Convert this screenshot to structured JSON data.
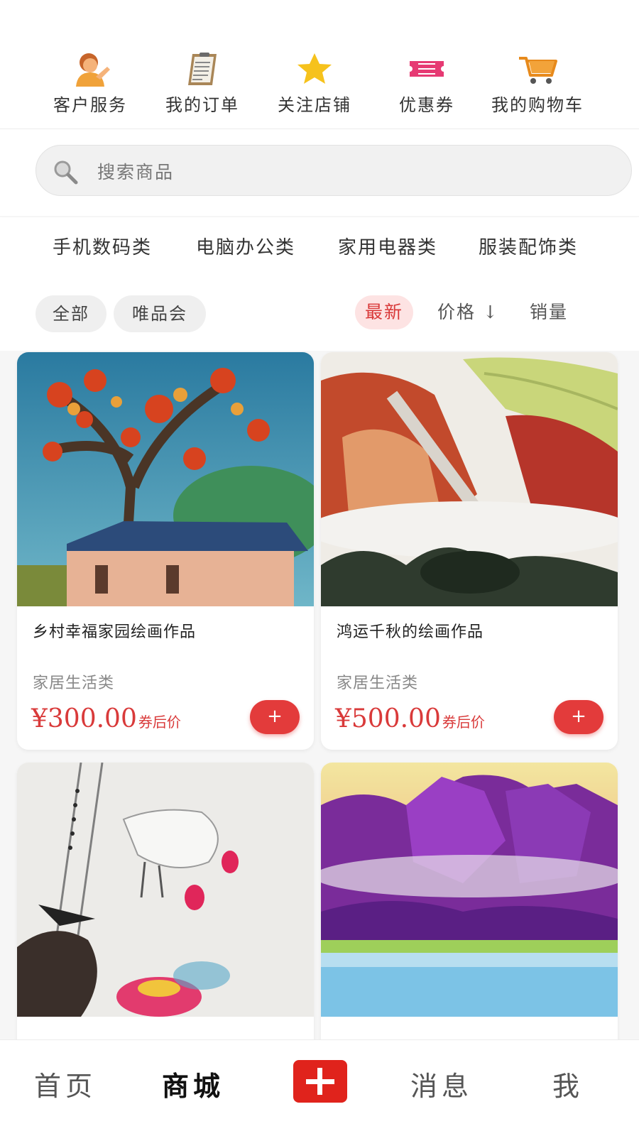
{
  "quick_menu": [
    {
      "label": "客户服务",
      "icon": "customer-service-icon"
    },
    {
      "label": "我的订单",
      "icon": "clipboard-icon"
    },
    {
      "label": "关注店铺",
      "icon": "star-icon"
    },
    {
      "label": "优惠券",
      "icon": "ticket-icon"
    },
    {
      "label": "我的购物车",
      "icon": "shopping-cart-icon"
    }
  ],
  "search": {
    "placeholder": "搜索商品",
    "icon": "search-icon"
  },
  "categories": [
    "手机数码类",
    "电脑办公类",
    "家用电器类",
    "服装配饰类"
  ],
  "filters": {
    "chips": [
      "全部",
      "唯品会"
    ],
    "sort": {
      "newest": "最新",
      "price": "价格 ↓",
      "sales": "销量"
    },
    "active_sort": "newest"
  },
  "products": [
    {
      "title": "乡村幸福家园绘画作品",
      "category": "家居生活类",
      "price": "¥300.00",
      "price_note": "券后价",
      "add_label": "+"
    },
    {
      "title": "鸿运千秋的绘画作品",
      "category": "家居生活类",
      "price": "¥500.00",
      "price_note": "券后价",
      "add_label": "+"
    },
    {
      "title": "",
      "category": "",
      "price": "",
      "price_note": "",
      "add_label": ""
    },
    {
      "title": "",
      "category": "",
      "price": "",
      "price_note": "",
      "add_label": ""
    }
  ],
  "tabbar": {
    "home": "首页",
    "mall": "商城",
    "messages": "消息",
    "me": "我",
    "active": "mall"
  },
  "colors": {
    "accent": "#e33b3b",
    "price": "#d93a3a",
    "tab_plus": "#e0231c"
  }
}
